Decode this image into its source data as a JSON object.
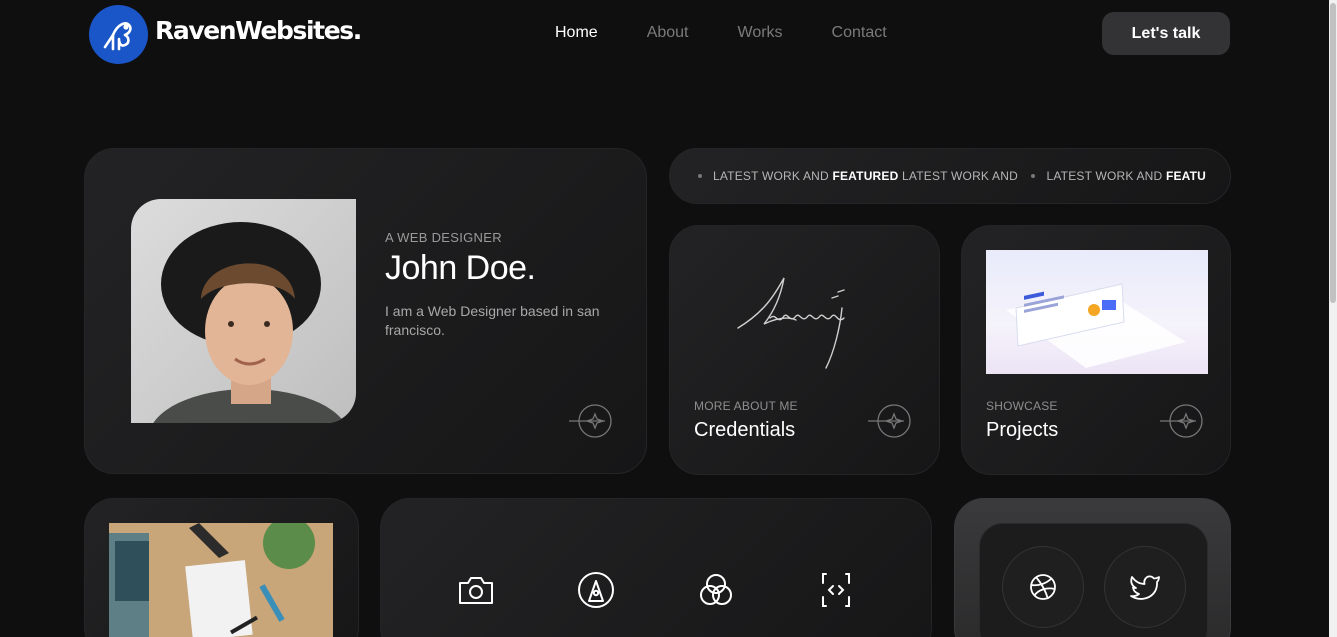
{
  "brand": {
    "name": "RavenWebsites.",
    "accent": "#1a56c8"
  },
  "nav": {
    "items": [
      "Home",
      "About",
      "Works",
      "Contact"
    ],
    "active": "Home"
  },
  "cta": {
    "label": "Let's talk"
  },
  "hero": {
    "eyebrow": "A WEB DESIGNER",
    "name": "John Doe.",
    "bio": "I am a Web Designer based in san francisco."
  },
  "marquee": {
    "segments": [
      {
        "text": "LATEST WORK AND ",
        "bold": "FEATURED",
        "tail": " LATEST WORK AND "
      },
      {
        "text": "LATEST WORK AND ",
        "bold": "FEATURED",
        "tail": ""
      }
    ]
  },
  "credentials": {
    "label": "MORE ABOUT ME",
    "title": "Credentials"
  },
  "projects": {
    "label": "SHOWCASE",
    "title": "Projects"
  },
  "services": {
    "icons": [
      "camera-icon",
      "pen-nib-icon",
      "color-circles-icon",
      "code-icon"
    ]
  },
  "social": {
    "icons": [
      "dribbble-icon",
      "twitter-icon"
    ]
  }
}
